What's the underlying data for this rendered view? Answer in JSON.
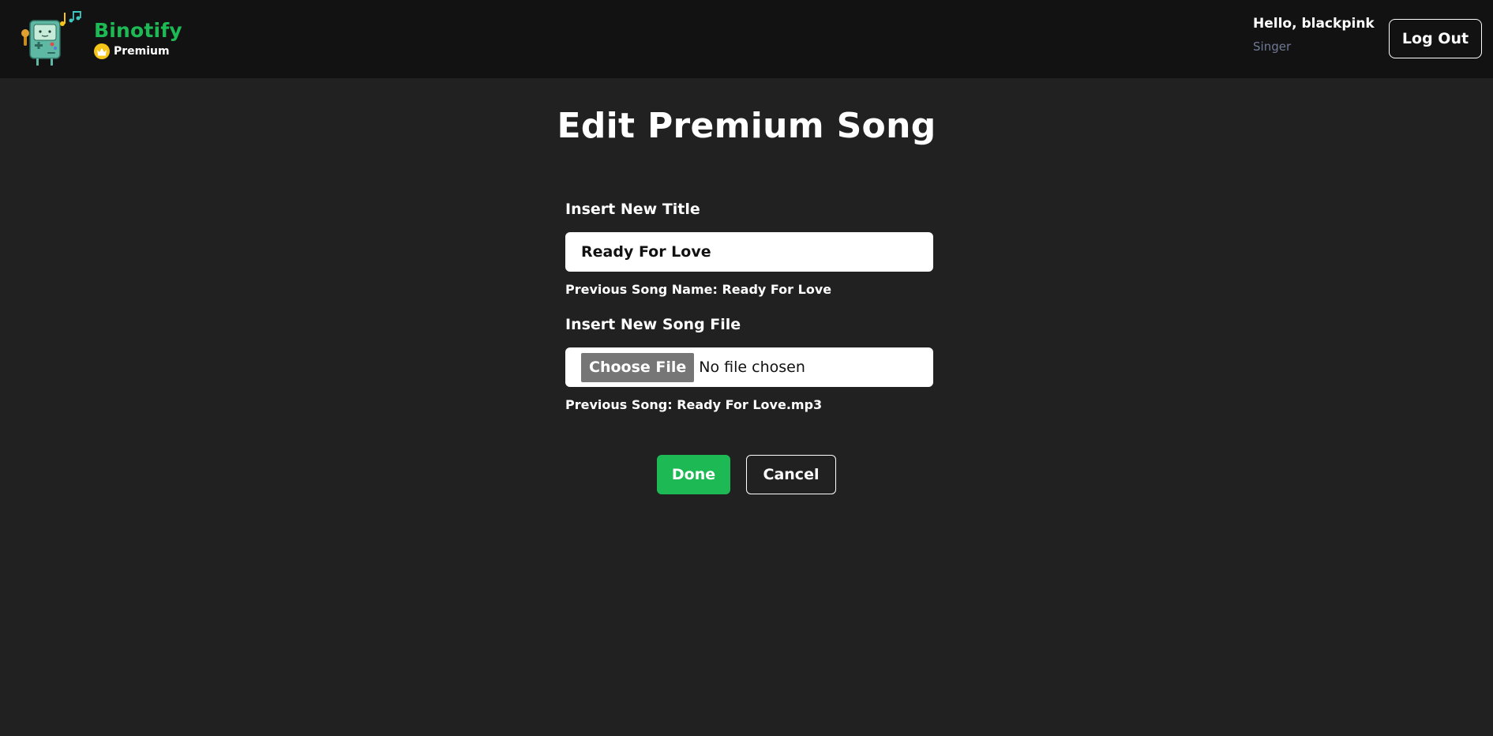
{
  "header": {
    "brand_name": "Binotify",
    "premium_label": "Premium",
    "logo_icon": "bmo-music-icon",
    "crown_icon": "crown-icon",
    "greeting": "Hello, blackpink",
    "role": "Singer",
    "logout_label": "Log Out"
  },
  "main": {
    "title": "Edit Premium Song",
    "title_field": {
      "label": "Insert New Title",
      "value": "Ready For Love",
      "hint": "Previous Song Name: Ready For Love"
    },
    "file_field": {
      "label": "Insert New Song File",
      "button_label": "Choose File",
      "status": "No file chosen",
      "hint": "Previous Song: Ready For Love.mp3"
    },
    "done_label": "Done",
    "cancel_label": "Cancel"
  },
  "colors": {
    "accent": "#1db954",
    "header_bg": "#121212",
    "page_bg": "#212121",
    "role_text": "#6f7a94",
    "crown": "#f5c518"
  }
}
